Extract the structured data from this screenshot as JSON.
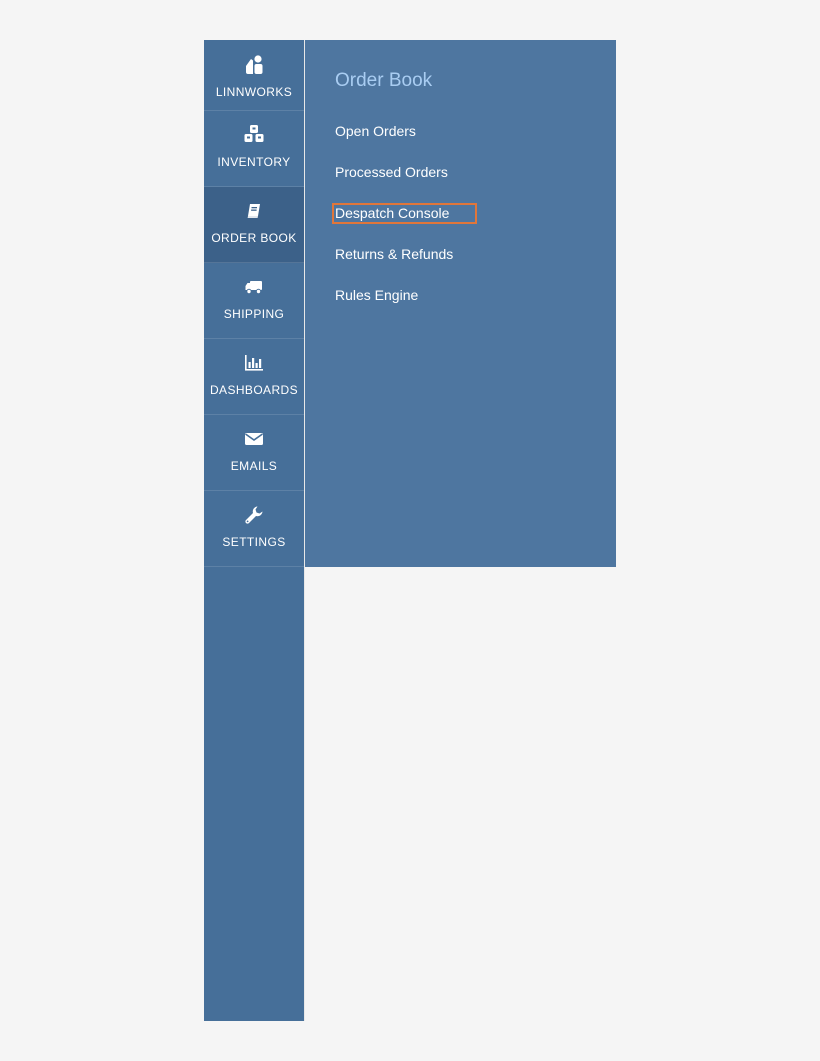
{
  "sidebar": {
    "items": [
      {
        "label": "LINNWORKS",
        "icon": "linnworks-logo-icon",
        "active": false
      },
      {
        "label": "INVENTORY",
        "icon": "boxes-icon",
        "active": false
      },
      {
        "label": "ORDER BOOK",
        "icon": "book-icon",
        "active": true
      },
      {
        "label": "SHIPPING",
        "icon": "truck-icon",
        "active": false
      },
      {
        "label": "DASHBOARDS",
        "icon": "bar-chart-icon",
        "active": false
      },
      {
        "label": "EMAILS",
        "icon": "envelope-icon",
        "active": false
      },
      {
        "label": "SETTINGS",
        "icon": "wrench-icon",
        "active": false
      }
    ]
  },
  "flyout": {
    "title": "Order Book",
    "links": [
      {
        "label": "Open Orders"
      },
      {
        "label": "Processed Orders"
      },
      {
        "label": "Despatch Console",
        "highlighted": true
      },
      {
        "label": "Returns & Refunds"
      },
      {
        "label": "Rules Engine"
      }
    ]
  },
  "colors": {
    "sidebar_bg": "#466f99",
    "sidebar_active_bg": "#3c6189",
    "flyout_bg": "#4e76a0",
    "flyout_title": "#a9cdf2",
    "highlight_border": "#e0763a"
  }
}
